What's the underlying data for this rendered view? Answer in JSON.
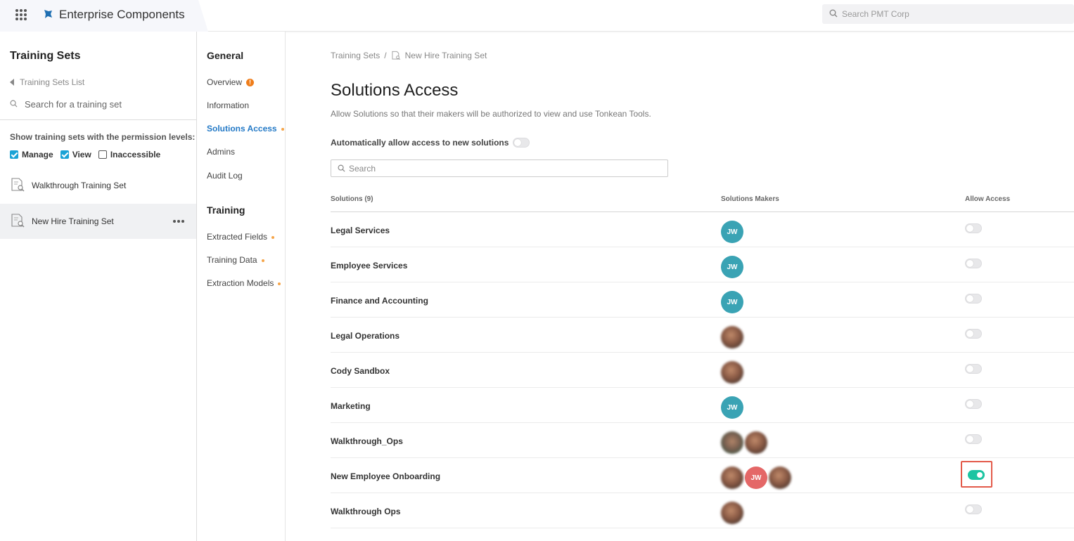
{
  "app": {
    "name": "Enterprise Components"
  },
  "top_search": {
    "placeholder": "Search PMT Corp"
  },
  "left_panel": {
    "title": "Training Sets",
    "back_label": "Training Sets List",
    "search_placeholder": "Search for a training set",
    "permission_label": "Show training sets with the permission levels:",
    "permissions": [
      {
        "label": "Manage",
        "checked": true
      },
      {
        "label": "View",
        "checked": true
      },
      {
        "label": "Inaccessible",
        "checked": false
      }
    ],
    "training_sets": [
      {
        "name": "Walkthrough Training Set",
        "active": false
      },
      {
        "name": "New Hire Training Set",
        "active": true
      }
    ]
  },
  "mid_nav": {
    "general_heading": "General",
    "general_items": [
      {
        "label": "Overview",
        "marker": "warning"
      },
      {
        "label": "Information",
        "marker": ""
      },
      {
        "label": "Solutions Access",
        "marker": "dot",
        "active": true
      },
      {
        "label": "Admins",
        "marker": ""
      },
      {
        "label": "Audit Log",
        "marker": ""
      }
    ],
    "training_heading": "Training",
    "training_items": [
      {
        "label": "Extracted Fields",
        "marker": "dot"
      },
      {
        "label": "Training Data",
        "marker": "dot"
      },
      {
        "label": "Extraction Models",
        "marker": "dot"
      }
    ]
  },
  "main": {
    "breadcrumb": {
      "parent": "Training Sets",
      "separator": "/",
      "current": "New Hire Training Set"
    },
    "title": "Solutions Access",
    "description": "Allow Solutions so that their makers will be authorized to view and use Tonkean Tools.",
    "auto_allow_label": "Automatically allow access to new solutions",
    "auto_allow_on": false,
    "search_placeholder": "Search",
    "columns": {
      "solutions": "Solutions (9)",
      "makers": "Solutions Makers",
      "access": "Allow Access"
    },
    "rows": [
      {
        "name": "Legal Services",
        "makers": [
          {
            "type": "initials",
            "text": "JW",
            "color": "teal"
          }
        ],
        "allowed": false
      },
      {
        "name": "Employee Services",
        "makers": [
          {
            "type": "initials",
            "text": "JW",
            "color": "teal"
          }
        ],
        "allowed": false
      },
      {
        "name": "Finance and Accounting",
        "makers": [
          {
            "type": "initials",
            "text": "JW",
            "color": "teal"
          }
        ],
        "allowed": false
      },
      {
        "name": "Legal Operations",
        "makers": [
          {
            "type": "photo"
          }
        ],
        "allowed": false
      },
      {
        "name": "Cody Sandbox",
        "makers": [
          {
            "type": "photo"
          }
        ],
        "allowed": false
      },
      {
        "name": "Marketing",
        "makers": [
          {
            "type": "initials",
            "text": "JW",
            "color": "teal"
          }
        ],
        "allowed": false
      },
      {
        "name": "Walkthrough_Ops",
        "makers": [
          {
            "type": "photo2"
          },
          {
            "type": "photo"
          }
        ],
        "allowed": false
      },
      {
        "name": "New Employee Onboarding",
        "makers": [
          {
            "type": "photo"
          },
          {
            "type": "initials",
            "text": "JW",
            "color": "red"
          },
          {
            "type": "photo"
          }
        ],
        "allowed": true,
        "highlighted": true
      },
      {
        "name": "Walkthrough Ops",
        "makers": [
          {
            "type": "photo"
          }
        ],
        "allowed": false
      }
    ]
  },
  "colors": {
    "accent": "#2379c6",
    "toggle_on": "#1dc4a2",
    "highlight": "#e35a4a",
    "avatar_teal": "#3aa3b4",
    "avatar_red": "#e46767"
  }
}
